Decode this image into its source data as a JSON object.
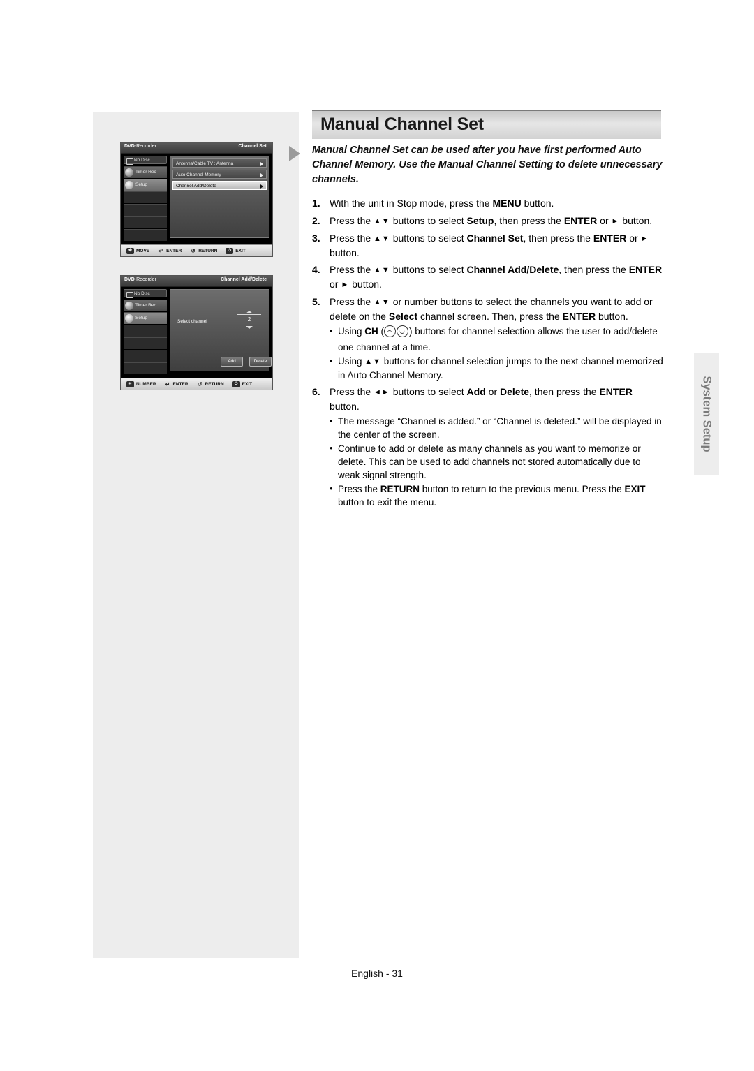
{
  "page": {
    "title": "Manual Channel Set",
    "footer": "English - 31",
    "side_tab": "System Setup"
  },
  "intro": "Manual Channel Set can be used after you have first performed Auto Channel Memory. Use the Manual Channel Setting to delete unnecessary channels.",
  "steps": [
    {
      "num": "1.",
      "html": "With the unit in Stop mode, press the <span class=\"b\">MENU</span> button."
    },
    {
      "num": "2.",
      "html": "Press the <span class=\"tri\">▲▼</span> buttons to select <span class=\"b\">Setup</span>, then press the <span class=\"b\">ENTER</span> or <span class=\"tri\">►</span> button."
    },
    {
      "num": "3.",
      "html": "Press the <span class=\"tri\">▲▼</span> buttons to select <span class=\"b\">Channel Set</span>, then press the <span class=\"b\">ENTER</span> or <span class=\"tri\">►</span> button."
    },
    {
      "num": "4.",
      "html": "Press the <span class=\"tri\">▲▼</span> buttons to select <span class=\"b\">Channel Add/Delete</span>, then press the <span class=\"b\">ENTER</span> or <span class=\"tri\">►</span> button."
    },
    {
      "num": "5.",
      "html": "Press the <span class=\"tri\">▲▼</span> or number buttons to select the channels you want to add or delete on the <span class=\"b\">Select</span> channel screen. Then, press the <span class=\"b\">ENTER</span> button."
    },
    {
      "num": "6.",
      "html": "Press the <span class=\"tri\">◄►</span> buttons to select <span class=\"b\">Add</span> or <span class=\"b\">Delete</span>, then press the <span class=\"b\">ENTER</span> button."
    }
  ],
  "bullets_5": [
    "Using <span class=\"b\">CH</span> (<span class=\"ch-icons\"><span class=\"ch-circ\"></span><span class=\"ch-circ dn\"></span></span>) buttons for channel selection allows the user to add/delete one channel at a time.",
    "Using <span class=\"tri\">▲▼</span> buttons for channel selection jumps to the next channel memorized in Auto Channel Memory."
  ],
  "bullets_6": [
    "The message “Channel is added.” or “Channel is deleted.” will be displayed in the center of the screen.",
    "Continue to add or delete as many channels as you want to memorize or delete. This can be used to add channels not stored automatically due to weak signal strength.",
    "Press the <span class=\"b\">RETURN</span> button to return to the previous menu. Press the <span class=\"b\">EXIT</span> button to exit the menu."
  ],
  "osd1": {
    "brand": "DVD",
    "brand_suffix": "-Recorder",
    "screen_title": "Channel Set",
    "disc": "No Disc",
    "sidebar": [
      {
        "label": "Timer Rec",
        "icon": "clock-icon"
      },
      {
        "label": "Setup",
        "icon": "gear-icon"
      }
    ],
    "menu": [
      {
        "label": "Antenna/Cable TV : Antenna",
        "selected": false
      },
      {
        "label": "Auto Channel Memory",
        "selected": false
      },
      {
        "label": "Channel Add/Delete",
        "selected": true
      }
    ],
    "footer": [
      {
        "icon": "✥",
        "label": "MOVE"
      },
      {
        "icon": "↵",
        "label": "ENTER"
      },
      {
        "icon": "↺",
        "label": "RETURN"
      },
      {
        "icon": "⏻",
        "label": "EXIT"
      }
    ]
  },
  "osd2": {
    "brand": "DVD",
    "brand_suffix": "-Recorder",
    "screen_title": "Channel Add/Delete",
    "disc": "No Disc",
    "sidebar": [
      {
        "label": "Timer Rec",
        "icon": "clock-icon"
      },
      {
        "label": "Setup",
        "icon": "gear-icon"
      }
    ],
    "select_label": "Select channel :",
    "channel_value": "2",
    "add_label": "Add",
    "delete_label": "Delete",
    "footer": [
      {
        "icon": "⌗",
        "label": "NUMBER"
      },
      {
        "icon": "↵",
        "label": "ENTER"
      },
      {
        "icon": "↺",
        "label": "RETURN"
      },
      {
        "icon": "⏻",
        "label": "EXIT"
      }
    ]
  }
}
